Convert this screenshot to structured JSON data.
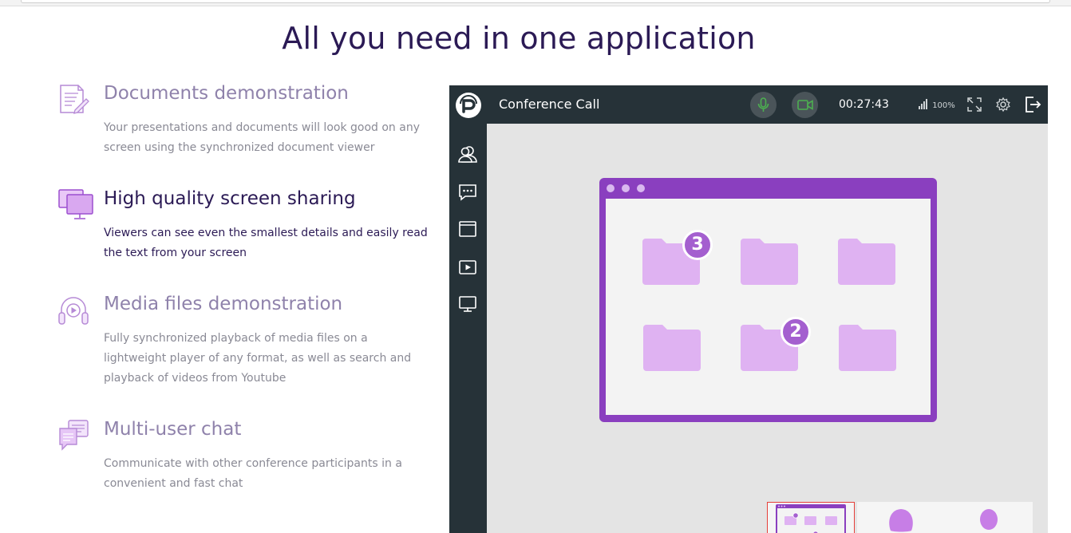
{
  "page": {
    "title": "All you need in one application"
  },
  "features": [
    {
      "title": "Documents demonstration",
      "description": "Your presentations and documents will look good on any screen using the synchronized document viewer",
      "icon": "document-edit-icon",
      "active": false
    },
    {
      "title": "High quality screen sharing",
      "description": "Viewers can see even the smallest details and easily read the text from your screen",
      "icon": "monitors-icon",
      "active": true
    },
    {
      "title": "Media files demonstration",
      "description": "Fully synchronized playback of media files on a lightweight player of any format, as well as search and playback of videos from Youtube",
      "icon": "headphones-play-icon",
      "active": false
    },
    {
      "title": "Multi-user chat",
      "description": "Communicate with other conference participants in a convenient and fast chat",
      "icon": "chat-bubbles-icon",
      "active": false
    }
  ],
  "app": {
    "title": "Conference Call",
    "timer": "00:27:43",
    "signal_label": "100%",
    "header_icons": [
      "microphone-icon",
      "camera-icon",
      "signal-icon",
      "fullscreen-icon",
      "gear-icon",
      "exit-icon"
    ],
    "sidebar_icons": [
      "users-icon",
      "chat-icon",
      "window-icon",
      "video-play-icon",
      "monitor-icon"
    ],
    "shared_screen": {
      "badges": [
        "3",
        "2"
      ]
    },
    "thumbnails": [
      "screen-share-thumbnail",
      "female-participant",
      "male-participant"
    ]
  },
  "colors": {
    "heading": "#2b1a55",
    "muted_text": "#8a8a95",
    "feature_muted_title": "#8f82ab",
    "accent_purple": "#8a3fbf",
    "folder_purple": "#dfb2f2",
    "app_dark": "#263238",
    "mic_green": "#4caf50",
    "selection_red": "#e5403a"
  }
}
